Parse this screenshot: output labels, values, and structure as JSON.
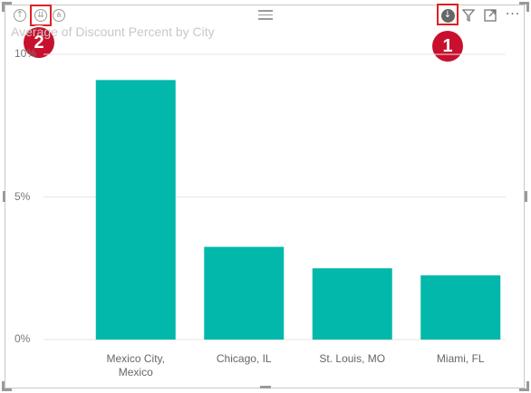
{
  "visual": {
    "title": "Average of Discount Percent by City",
    "title_partial": "Av       of Discount Percent by City"
  },
  "toolbar_left": {
    "icons": [
      "drill-up-icon",
      "drill-down-mode-icon",
      "expand-hierarchy-icon"
    ]
  },
  "toolbar_right": {
    "icons": [
      "drill-down-icon",
      "filter-icon",
      "focus-mode-icon",
      "more-options-icon"
    ],
    "more_label": "···"
  },
  "callouts": {
    "one": "1",
    "two": "2"
  },
  "colors": {
    "bar": "#01B8AA",
    "callout": "#C8102E",
    "highlight": "#E02020",
    "gridline": "#E6E6E6"
  },
  "chart_data": {
    "type": "bar",
    "title": "Average of Discount Percent by City",
    "categories": [
      "Mexico City, Mexico",
      "Chicago, IL",
      "St. Louis, MO",
      "Miami, FL"
    ],
    "category_lines": [
      [
        "Mexico City,",
        "Mexico"
      ],
      [
        "Chicago, IL"
      ],
      [
        "St. Louis, MO"
      ],
      [
        "Miami, FL"
      ]
    ],
    "values": [
      9.1,
      3.25,
      2.5,
      2.25
    ],
    "unit": "%",
    "yticks": [
      "0%",
      "5%",
      "10%"
    ],
    "ytick_values": [
      0,
      5,
      10
    ],
    "ylim": [
      0,
      10
    ],
    "grid": true
  }
}
